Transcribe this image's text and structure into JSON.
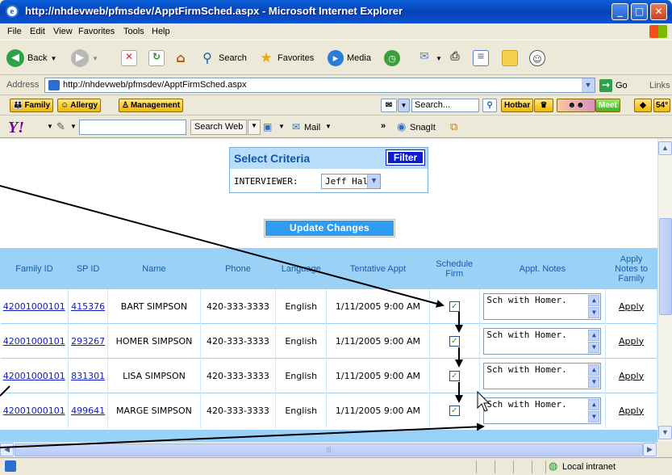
{
  "window": {
    "title": "http://nhdevweb/pfmsdev/ApptFirmSched.aspx - Microsoft Internet Explorer",
    "min": "_",
    "max": "□",
    "close": "✕"
  },
  "menu": [
    "File",
    "Edit",
    "View",
    "Favorites",
    "Tools",
    "Help"
  ],
  "toolbar": {
    "back": "Back",
    "search": "Search",
    "favorites": "Favorites",
    "media": "Media"
  },
  "address": {
    "label": "Address",
    "url": "http://nhdevweb/pfmsdev/ApptFirmSched.aspx",
    "go": "Go",
    "links": "Links"
  },
  "linkbar": {
    "family": "Family",
    "allergy": "Allergy",
    "management": "Management",
    "search_placeholder": "Search...",
    "hotbar": "Hotbar",
    "meet": "Meet",
    "temp": "54°"
  },
  "yahoo": {
    "logo": "Y!",
    "search_web": "Search Web",
    "mail": "Mail",
    "more": "»",
    "snagit": "SnagIt"
  },
  "criteria": {
    "title": "Select Criteria",
    "filter": "Filter",
    "interviewer_label": "INTERVIEWER:",
    "interviewer_value": "Jeff Hall"
  },
  "update_button": "Update Changes",
  "table": {
    "headers": {
      "family_id": "Family ID",
      "sp_id": "SP ID",
      "name": "Name",
      "phone": "Phone",
      "language": "Language",
      "tentative": "Tentative Appt",
      "schedule_firm": "Schedule Firm",
      "notes": "Appt. Notes",
      "apply": "Apply Notes to Family"
    },
    "rows": [
      {
        "family_id": "42001000101",
        "sp_id": "415376",
        "name": "BART SIMPSON",
        "phone": "420-333-3333",
        "language": "English",
        "tentative": "1/11/2005 9:00 AM",
        "firm": "✓",
        "notes": "Sch with Homer.",
        "apply": "Apply"
      },
      {
        "family_id": "42001000101",
        "sp_id": "293267",
        "name": "HOMER SIMPSON",
        "phone": "420-333-3333",
        "language": "English",
        "tentative": "1/11/2005 9:00 AM",
        "firm": "✓",
        "notes": "Sch with Homer.",
        "apply": "Apply"
      },
      {
        "family_id": "42001000101",
        "sp_id": "831301",
        "name": "LISA SIMPSON",
        "phone": "420-333-3333",
        "language": "English",
        "tentative": "1/11/2005 9:00 AM",
        "firm": "✓",
        "notes": "Sch with Homer.",
        "apply": "Apply"
      },
      {
        "family_id": "42001000101",
        "sp_id": "499641",
        "name": "MARGE SIMPSON",
        "phone": "420-333-3333",
        "language": "English",
        "tentative": "1/11/2005 9:00 AM",
        "firm": "✓",
        "notes": "Sch with Homer.",
        "apply": "Apply"
      }
    ]
  },
  "status": {
    "zone": "Local intranet"
  },
  "colors": {
    "header_bg": "#9ad1f7",
    "header_text": "#1a5ca8",
    "link": "#0c1bc2",
    "filter_btn": "#0a1cd6",
    "update_btn": "#2f9cf0"
  },
  "icons": [
    "ie-icon",
    "back-icon",
    "forward-icon",
    "stop-icon",
    "refresh-icon",
    "home-icon",
    "search-icon",
    "favorites-icon",
    "media-icon",
    "history-icon",
    "mail-icon",
    "print-icon",
    "edit-icon",
    "folder-icon",
    "messenger-icon",
    "page-icon",
    "go-icon",
    "globe-icon"
  ]
}
